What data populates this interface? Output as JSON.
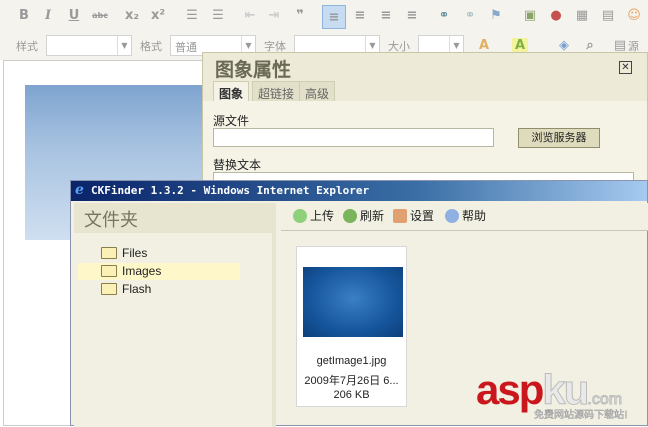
{
  "toolbar": {
    "row1_icons": [
      "bold",
      "italic",
      "underline",
      "strikethrough",
      "subscript",
      "superscript",
      "numbered-list",
      "bulleted-list",
      "outdent",
      "indent",
      "blockquote",
      "align-left",
      "align-center",
      "align-right",
      "justify",
      "link",
      "unlink",
      "anchor",
      "image",
      "flash",
      "table",
      "horizontal-rule",
      "smiley"
    ],
    "style_label": "样式",
    "format_label": "格式",
    "format_value": "普通",
    "font_label": "字体",
    "size_label": "大小",
    "source_label": "源码"
  },
  "dialog": {
    "title": "图象属性",
    "tabs": [
      "图象",
      "超链接",
      "高级"
    ],
    "src_label": "源文件",
    "browse_button": "浏览服务器",
    "alt_label": "替换文本"
  },
  "ckfinder": {
    "window_title": "CKFinder 1.3.2 - Windows Internet Explorer",
    "folders_header": "文件夹",
    "folders": [
      "Files",
      "Images",
      "Flash"
    ],
    "selected_folder": "Images",
    "actions": [
      "上传",
      "刷新",
      "设置",
      "帮助"
    ],
    "file": {
      "name": "getImage1.jpg",
      "date": "2009年7月26日  6...",
      "size": "206 KB"
    }
  },
  "watermark": {
    "brand": "aspku",
    "suffix": ".com",
    "tagline": "免费网站源码下载站!"
  },
  "colors": {
    "titlebar": "#0a246a",
    "watermark_red": "#c9171d"
  }
}
